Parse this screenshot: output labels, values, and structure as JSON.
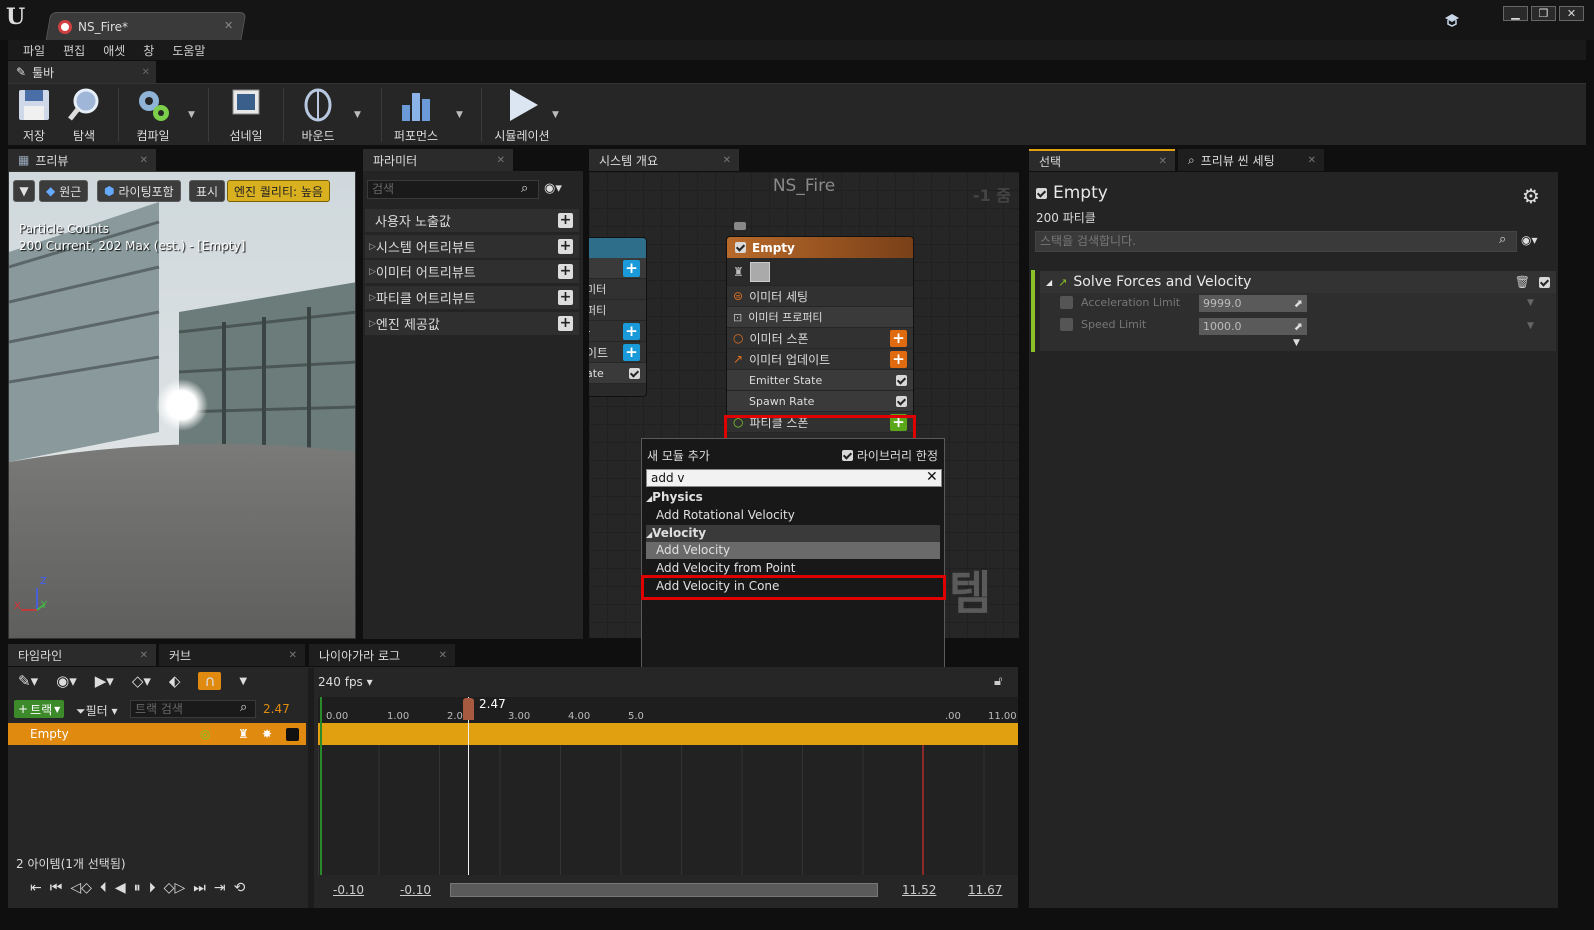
{
  "window": {
    "doc_tab": "NS_Fire*"
  },
  "menu": [
    "파일",
    "편집",
    "애셋",
    "창",
    "도움말"
  ],
  "toolbar_tab": "툴바",
  "toolbar": [
    {
      "label": "저장",
      "icon": "save-icon"
    },
    {
      "label": "탐색",
      "icon": "browse-icon"
    },
    {
      "label": "컴파일",
      "icon": "compile-icon"
    },
    {
      "label": "섬네일",
      "icon": "thumbnail-icon"
    },
    {
      "label": "바운드",
      "icon": "bounds-icon"
    },
    {
      "label": "퍼포먼스",
      "icon": "performance-icon"
    },
    {
      "label": "시뮬레이션",
      "icon": "play-icon"
    }
  ],
  "preview": {
    "tab": "프리뷰",
    "buttons": [
      "원근",
      "라이팅포함",
      "표시",
      "엔진 퀄리티: 높음"
    ],
    "overlay_title": "Particle Counts",
    "overlay_sub": "200 Current, 202 Max (est.) - [Empty]",
    "axis": {
      "z": "Z",
      "y": "Y",
      "x": "X"
    }
  },
  "params": {
    "tab": "파라미터",
    "search_placeholder": "검색",
    "rows": [
      "사용자 노출값",
      "시스템 어트리뷰트",
      "이미터 어트리뷰트",
      "파티클 어트리뷰트",
      "엔진 제공값"
    ]
  },
  "graph": {
    "tab": "시스템 개요",
    "title": "NS_Fire",
    "zoom": "-1 줌",
    "watermark": "템",
    "left_node_rows": [
      "!",
      "미터",
      "퍼티",
      "-",
      "이트",
      "ate"
    ],
    "node": {
      "title": "Empty",
      "rows": [
        {
          "label": "이미터 세팅"
        },
        {
          "label": "이미터 프로퍼티"
        },
        {
          "label": "이미터 스폰"
        },
        {
          "label": "이미터 업데이트"
        },
        {
          "label": "Emitter State"
        },
        {
          "label": "Spawn Rate"
        },
        {
          "label": "파티클 스폰"
        }
      ]
    }
  },
  "popup": {
    "title": "새 모듈 추가",
    "library_only": "라이브러리 한정",
    "search_value": "add v",
    "items": [
      {
        "text": "Physics",
        "kind": "category"
      },
      {
        "text": "Add Rotational Velocity",
        "kind": "item"
      },
      {
        "text": "Velocity",
        "kind": "category"
      },
      {
        "text": "Add Velocity",
        "kind": "item"
      },
      {
        "text": "Add Velocity from Point",
        "kind": "item"
      },
      {
        "text": "Add Velocity in Cone",
        "kind": "item"
      }
    ]
  },
  "timeline": {
    "tabs": [
      "타임라인",
      "커브",
      "나이아가라 로그"
    ],
    "fps": "240 fps",
    "track_btn": "트랙",
    "filter_btn": "필터",
    "search_placeholder": "트랙 검색",
    "current_time": "2.47",
    "playhead": "2.47",
    "track_name": "Empty",
    "ticks": [
      "0.00",
      "1.00",
      "2.00",
      "3.00",
      "4.00",
      "5.0",
      ".00",
      "11.00"
    ],
    "status": "2 아이템(1개 선택됨)",
    "range": [
      "-0.10",
      "-0.10",
      "11.52",
      "11.67"
    ]
  },
  "selection": {
    "tabs": [
      "선택",
      "프리뷰 씬 세팅"
    ],
    "name": "Empty",
    "count": "200 파티클",
    "search_placeholder": "스택을 검색합니다.",
    "module": "Solve Forces and Velocity",
    "props": [
      {
        "label": "Acceleration Limit",
        "value": "9999.0"
      },
      {
        "label": "Speed Limit",
        "value": "1000.0"
      }
    ]
  }
}
